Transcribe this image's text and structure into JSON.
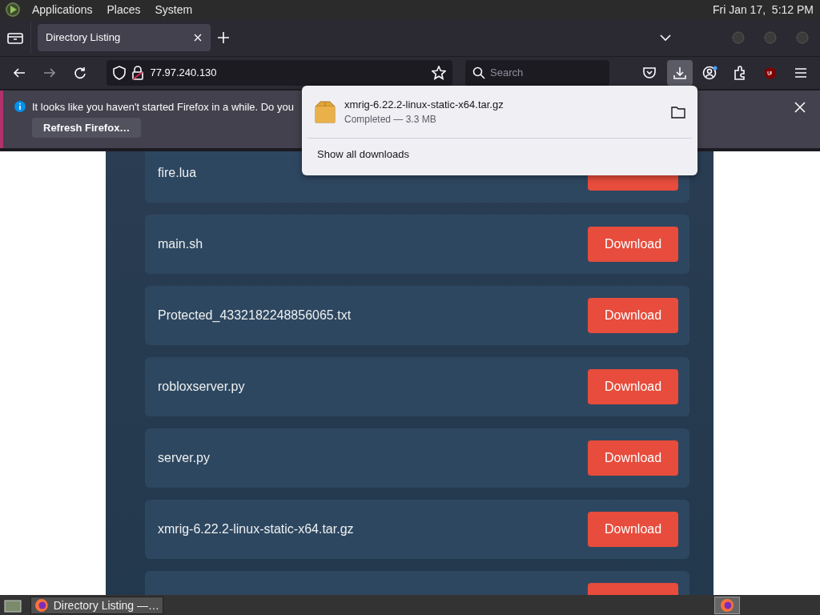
{
  "top_panel": {
    "menus": [
      "Applications",
      "Places",
      "System"
    ],
    "clock": "Fri Jan 17,  5:12 PM"
  },
  "tabs": [
    {
      "title": "Directory Listing",
      "selected": true
    }
  ],
  "address_bar": {
    "url": "77.97.240.130"
  },
  "search": {
    "placeholder": "Search"
  },
  "toolbar": {
    "downloads_active": true
  },
  "notification": {
    "message": "It looks like you haven't started Firefox in a while. Do you",
    "button": "Refresh Firefox…"
  },
  "files": [
    {
      "kind": "file",
      "name": "fire.lua"
    },
    {
      "kind": "file",
      "name": "main.sh",
      "button": "Download"
    },
    {
      "kind": "file",
      "name": "Protected_4332182248856065.txt",
      "button": "Download"
    },
    {
      "kind": "file",
      "name": "robloxserver.py",
      "button": "Download"
    },
    {
      "kind": "file",
      "name": "server.py",
      "button": "Download"
    },
    {
      "kind": "file",
      "name": "xmrig-6.22.2-linux-static-x64.tar.gz",
      "button": "Download"
    },
    {
      "kind": "cut"
    }
  ],
  "downloads_panel": {
    "file": "xmrig-6.22.2-linux-static-x64.tar.gz",
    "status": "Completed — 3.3 MB",
    "footer": "Show all downloads"
  },
  "taskbar": {
    "tasks": [
      {
        "title": "Directory Listing —…"
      }
    ]
  }
}
